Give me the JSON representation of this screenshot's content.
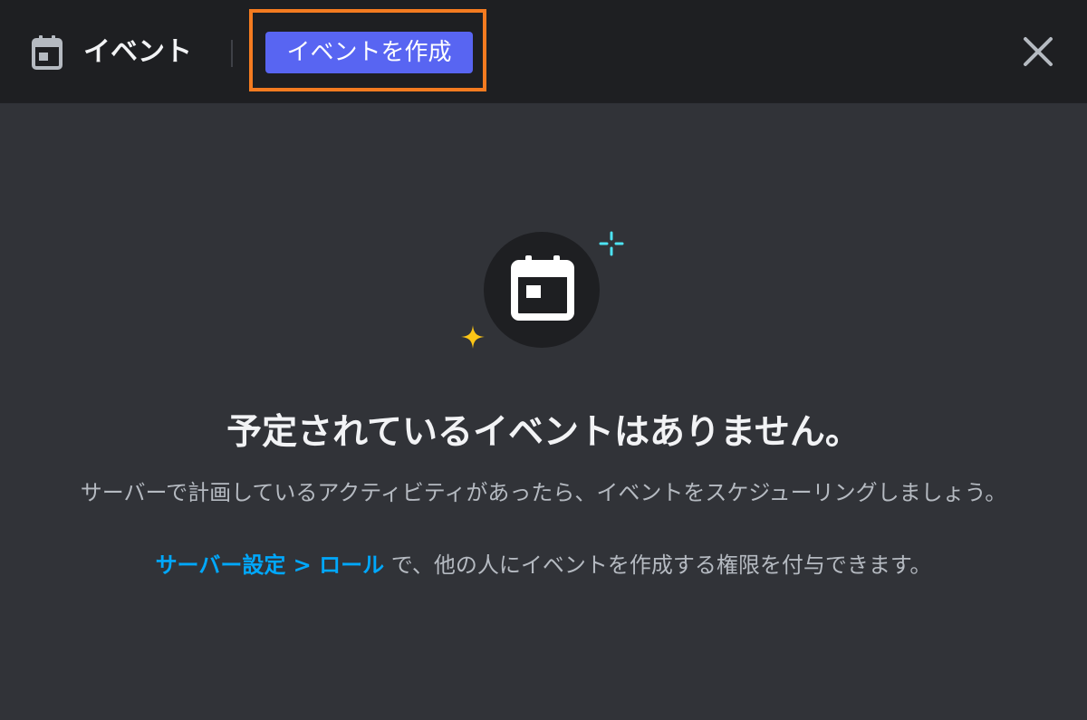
{
  "header": {
    "icon": "calendar-icon",
    "title": "イベント",
    "create_button_label": "イベントを作成",
    "close_icon": "close-icon",
    "highlight_color": "#f47b20",
    "button_color": "#5865f2"
  },
  "empty_state": {
    "illustration_icon": "calendar-icon",
    "sparkle_colors": [
      "#fbc516",
      "#4de3f2"
    ],
    "title": "予定されているイベントはありません。",
    "description": "サーバーで計画しているアクティビティがあったら、イベントをスケジューリングしましょう。",
    "settings_link": "サーバー設定 > ロール",
    "settings_suffix": " で、他の人にイベントを作成する権限を付与できます。",
    "link_color": "#00a8fc"
  }
}
